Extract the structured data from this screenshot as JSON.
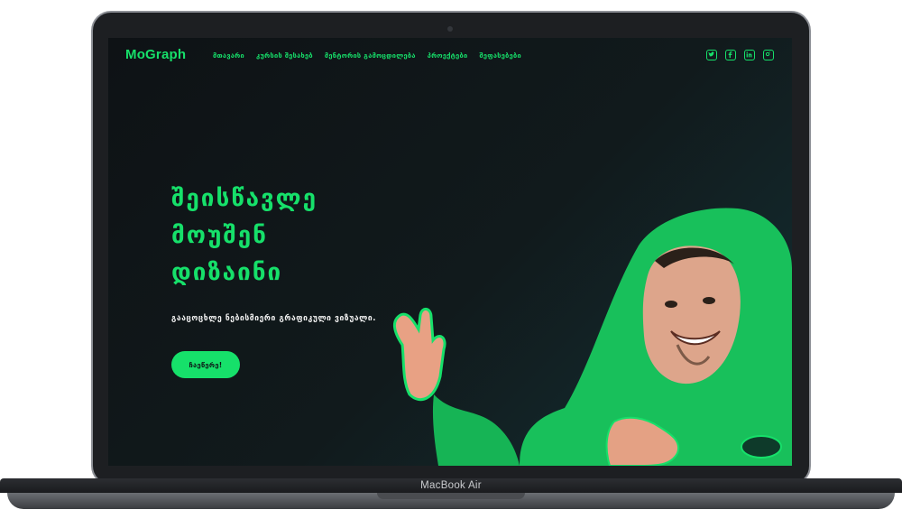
{
  "device": {
    "model_label": "MacBook Air"
  },
  "nav": {
    "logo": "MoGraph",
    "menu": [
      "მთავარი",
      "კურსის შესახებ",
      "მენტორის გამოცდილება",
      "პროექტები",
      "შეფასებები"
    ],
    "social_icons": [
      "twitter-icon",
      "facebook-icon",
      "linkedin-icon",
      "instagram-icon"
    ]
  },
  "hero": {
    "headline_lines": [
      "შეისწავლე",
      "მოუშენ",
      "დიზაინი"
    ],
    "subtitle": "გააცოცხლე ნებისმიერი გრაფიკული ვიზუალი.",
    "cta_label": "ჩაეწერე!"
  },
  "colors": {
    "accent": "#16e06a",
    "background": "#0e1215"
  }
}
